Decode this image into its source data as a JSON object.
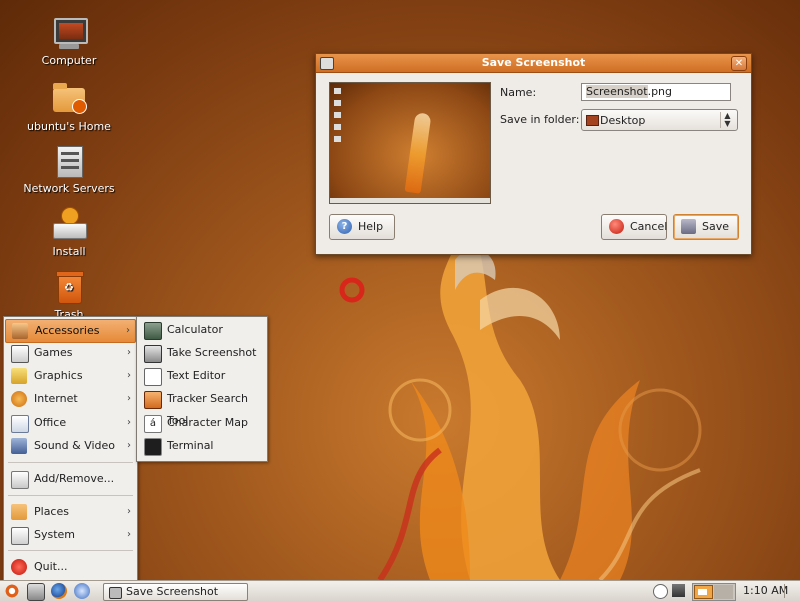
{
  "desktop": {
    "icons": [
      {
        "label": "Computer",
        "icon": "computer-icon"
      },
      {
        "label": "ubuntu's Home",
        "icon": "home-folder-icon"
      },
      {
        "label": "Network Servers",
        "icon": "network-servers-icon"
      },
      {
        "label": "Install",
        "icon": "install-icon"
      },
      {
        "label": "Trash",
        "icon": "trash-icon"
      }
    ]
  },
  "dialog": {
    "title": "Save Screenshot",
    "name_label": "Name:",
    "name_value_selected": "Screenshot",
    "name_value_ext": ".png",
    "folder_label": "Save in folder:",
    "folder_value": "Desktop",
    "help_label": "Help",
    "cancel_label": "Cancel",
    "save_label": "Save"
  },
  "main_menu": {
    "items": [
      {
        "label": "Accessories",
        "icon": "accessories-icon",
        "has_submenu": true,
        "active": true
      },
      {
        "label": "Games",
        "icon": "games-icon",
        "has_submenu": true
      },
      {
        "label": "Graphics",
        "icon": "graphics-icon",
        "has_submenu": true
      },
      {
        "label": "Internet",
        "icon": "internet-icon",
        "has_submenu": true
      },
      {
        "label": "Office",
        "icon": "office-icon",
        "has_submenu": true
      },
      {
        "label": "Sound & Video",
        "icon": "sound-video-icon",
        "has_submenu": true
      },
      {
        "label": "Add/Remove...",
        "icon": "add-remove-icon",
        "has_submenu": false
      },
      {
        "label": "Places",
        "icon": "places-icon",
        "has_submenu": true
      },
      {
        "label": "System",
        "icon": "system-icon",
        "has_submenu": true
      },
      {
        "label": "Quit...",
        "icon": "quit-icon",
        "has_submenu": false
      }
    ]
  },
  "accessories_menu": {
    "items": [
      {
        "label": "Calculator",
        "icon": "calculator-icon"
      },
      {
        "label": "Take Screenshot",
        "icon": "camera-icon"
      },
      {
        "label": "Text Editor",
        "icon": "text-editor-icon"
      },
      {
        "label": "Tracker Search Tool",
        "icon": "search-tool-icon"
      },
      {
        "label": "Character Map",
        "icon": "character-map-icon",
        "glyph": "á"
      },
      {
        "label": "Terminal",
        "icon": "terminal-icon"
      }
    ]
  },
  "panel": {
    "task_label": "Save Screenshot",
    "clock": "1:10 AM"
  },
  "colors": {
    "accent": "#e58a38",
    "title_bar": "#cf6f24",
    "desktop": "#a35a1e"
  }
}
